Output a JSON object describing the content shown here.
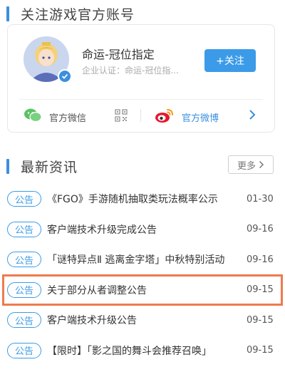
{
  "follow_section": {
    "title": "关注游戏官方账号",
    "account": {
      "name": "命运-冠位指定",
      "certification": "企业认证：命运-冠位指...",
      "follow_label": "+关注"
    },
    "social": {
      "wechat_label": "官方微信",
      "weibo_label": "官方微博"
    }
  },
  "news_section": {
    "title": "最新资讯",
    "more_label": "更多"
  },
  "news": [
    {
      "tag": "公告",
      "title": "《FGO》手游随机抽取类玩法概率公示",
      "date": "01-30"
    },
    {
      "tag": "公告",
      "title": "客户端技术升级完成公告",
      "date": "09-16"
    },
    {
      "tag": "公告",
      "title": "「谜特异点Ⅱ 逃离金字塔」中秋特别活动",
      "date": "09-16"
    },
    {
      "tag": "公告",
      "title": "关于部分从者调整公告",
      "date": "09-15",
      "highlighted": true
    },
    {
      "tag": "公告",
      "title": "客户端技术升级公告",
      "date": "09-15"
    },
    {
      "tag": "公告",
      "title": "【限时】「影之国的舞斗会推荐召唤」",
      "date": "09-15"
    }
  ],
  "colors": {
    "accent": "#3b9be8",
    "highlight": "#ef7a4d"
  }
}
